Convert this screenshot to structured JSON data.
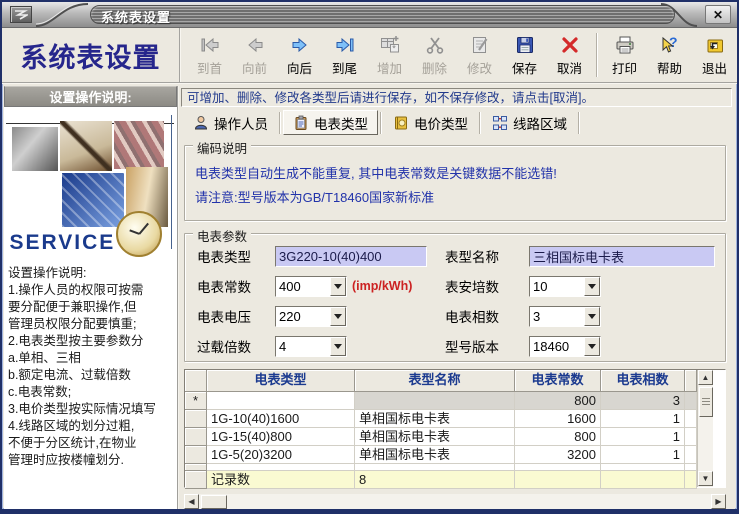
{
  "window": {
    "titlebar_title": "系统表设置",
    "close_glyph": "✕"
  },
  "toolbar": {
    "app_title": "系统表设置",
    "buttons": [
      {
        "label": "到首"
      },
      {
        "label": "向前"
      },
      {
        "label": "向后"
      },
      {
        "label": "到尾"
      },
      {
        "label": "增加"
      },
      {
        "label": "删除"
      },
      {
        "label": "修改"
      },
      {
        "label": "保存"
      },
      {
        "label": "取消"
      },
      {
        "label": "打印"
      },
      {
        "label": "帮助"
      },
      {
        "label": "退出"
      }
    ]
  },
  "sidebar": {
    "header": "设置操作说明:",
    "service_text": "SERVICE",
    "instructions": "设置操作说明:\n1.操作人员的权限可按需\n要分配便于兼职操作,但\n管理员权限分配要慎重;\n2.电表类型按主要参数分\n a.单相、三相\n b.额定电流、过载倍数\n c.电表常数;\n3.电价类型按实际情况填写\n4.线路区域的划分过粗,\n不便于分区统计,在物业\n管理时应按楼幢划分."
  },
  "hint": "可增加、删除、修改各类型后请进行保存，如不保存修改，请点击[取消]。",
  "tabs": [
    {
      "label": "操作人员"
    },
    {
      "label": "电表类型"
    },
    {
      "label": "电价类型"
    },
    {
      "label": "线路区域"
    }
  ],
  "encoding": {
    "title": "编码说明",
    "line1": "电表类型自动生成不能重复, 其中电表常数是关键数据不能选错!",
    "line2": "请注意:型号版本为GB/T18460国家新标准"
  },
  "params": {
    "title": "电表参数",
    "meter_type": {
      "label": "电表类型",
      "value": "3G220-10(40)400"
    },
    "model_name": {
      "label": "表型名称",
      "value": "三相国标电卡表"
    },
    "constant": {
      "label": "电表常数",
      "value": "400",
      "suffix": "(imp/kWh)"
    },
    "amperage": {
      "label": "表安培数",
      "value": "10"
    },
    "voltage": {
      "label": "电表电压",
      "value": "220"
    },
    "phases": {
      "label": "电表相数",
      "value": "3"
    },
    "overload": {
      "label": "过载倍数",
      "value": "4"
    },
    "version": {
      "label": "型号版本",
      "value": "18460"
    }
  },
  "grid": {
    "headers": [
      "电表类型",
      "表型名称",
      "电表常数",
      "电表相数"
    ],
    "new_row": {
      "marker": "*",
      "type": "",
      "name": "",
      "constant": "800",
      "phases": "3"
    },
    "rows": [
      {
        "type": "1G-10(40)1600",
        "name": "单相国标电卡表",
        "constant": "1600",
        "phases": "1"
      },
      {
        "type": "1G-15(40)800",
        "name": "单相国标电卡表",
        "constant": "800",
        "phases": "1"
      },
      {
        "type": "1G-5(20)3200",
        "name": "单相国标电卡表",
        "constant": "3200",
        "phases": "1"
      }
    ],
    "footer": {
      "label": "记录数",
      "value": "8"
    }
  },
  "colors": {
    "note_blue": "#2233aa",
    "warn_red": "#cc2222",
    "field_lavender": "#c9c9f3",
    "grid_header_navy": "#1b3a8f",
    "title_navy": "#26268c",
    "footer_yellow": "#fafad2"
  }
}
